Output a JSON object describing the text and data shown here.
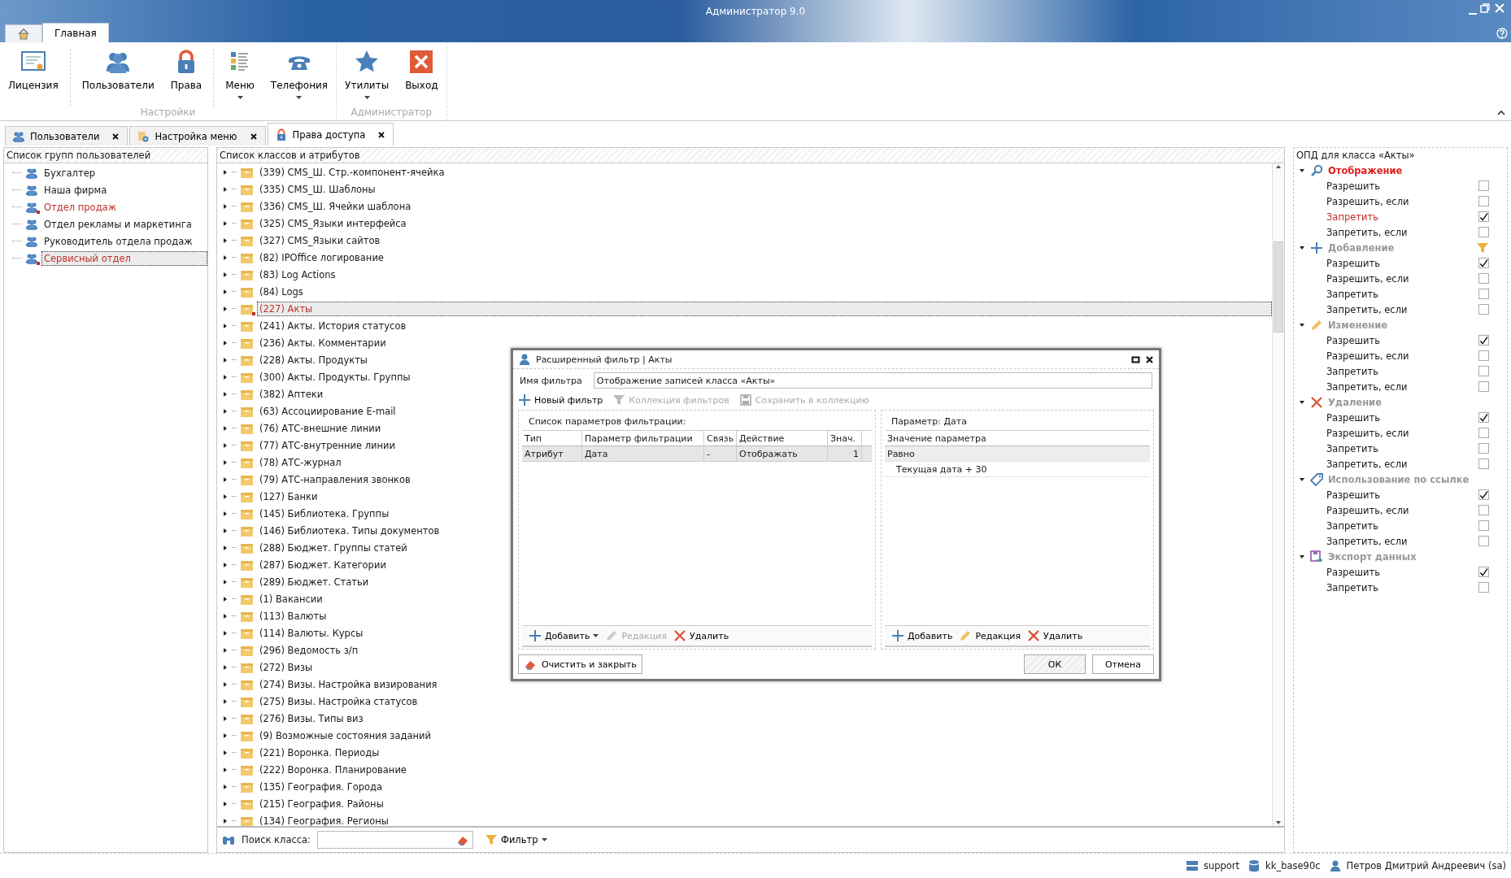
{
  "window": {
    "title": "Администратор 9.0"
  },
  "ribbon_tabs": [
    {
      "kind": "home",
      "selected": false
    },
    {
      "kind": "text",
      "label": "Главная",
      "selected": true
    }
  ],
  "ribbon_groups": [
    {
      "label": "Настройки",
      "buttons": [
        {
          "label": "Лицензия",
          "dropdown": false,
          "separated": false
        },
        {
          "label": "Пользователи",
          "dropdown": false,
          "separated": true
        },
        {
          "label": "Права",
          "dropdown": false,
          "separated": false
        },
        {
          "label": "Меню",
          "dropdown": true,
          "separated": true
        },
        {
          "label": "Телефония",
          "dropdown": true,
          "separated": false
        }
      ]
    },
    {
      "label": "Администратор",
      "buttons": [
        {
          "label": "Утилиты",
          "dropdown": true,
          "separated": false
        },
        {
          "label": "Выход",
          "dropdown": false,
          "separated": false
        }
      ]
    }
  ],
  "doc_tabs": [
    {
      "label": "Пользователи",
      "selected": false
    },
    {
      "label": "Настройка меню",
      "selected": false
    },
    {
      "label": "Права доступа",
      "selected": true
    }
  ],
  "groups_panel": {
    "title": "Список групп пользователей",
    "items": [
      {
        "label": "Бухгалтер",
        "restricted": false,
        "selected": false
      },
      {
        "label": "Наша фирма",
        "restricted": false,
        "selected": false
      },
      {
        "label": "Отдел продаж",
        "restricted": true,
        "selected": false
      },
      {
        "label": "Отдел рекламы и маркетинга",
        "restricted": false,
        "selected": false
      },
      {
        "label": "Руководитель отдела продаж",
        "restricted": false,
        "selected": false
      },
      {
        "label": "Сервисный отдел",
        "restricted": true,
        "selected": true
      }
    ]
  },
  "classes_panel": {
    "title": "Список классов и атрибутов",
    "items": [
      {
        "label": "(339) CMS_Ш. Стр.-компонент-ячейка",
        "restricted": false,
        "selected": false
      },
      {
        "label": "(335) CMS_Ш. Шаблоны",
        "restricted": false,
        "selected": false
      },
      {
        "label": "(336) CMS_Ш. Ячейки шаблона",
        "restricted": false,
        "selected": false
      },
      {
        "label": "(325) CMS_Языки интерфейса",
        "restricted": false,
        "selected": false
      },
      {
        "label": "(327) CMS_Языки сайтов",
        "restricted": false,
        "selected": false
      },
      {
        "label": "(82) IPOffice логирование",
        "restricted": false,
        "selected": false
      },
      {
        "label": "(83) Log Actions",
        "restricted": false,
        "selected": false
      },
      {
        "label": "(84) Logs",
        "restricted": false,
        "selected": false
      },
      {
        "label": "(227) Акты",
        "restricted": true,
        "selected": true
      },
      {
        "label": "(241) Акты. История статусов",
        "restricted": false,
        "selected": false
      },
      {
        "label": "(236) Акты. Комментарии",
        "restricted": false,
        "selected": false
      },
      {
        "label": "(228) Акты. Продукты",
        "restricted": false,
        "selected": false
      },
      {
        "label": "(300) Акты. Продукты. Группы",
        "restricted": false,
        "selected": false
      },
      {
        "label": "(382) Аптеки",
        "restricted": false,
        "selected": false
      },
      {
        "label": "(63) Ассоциирование E-mail",
        "restricted": false,
        "selected": false
      },
      {
        "label": "(76) АТС-внешние линии",
        "restricted": false,
        "selected": false
      },
      {
        "label": "(77) АТС-внутренние линии",
        "restricted": false,
        "selected": false
      },
      {
        "label": "(78) АТС-журнал",
        "restricted": false,
        "selected": false
      },
      {
        "label": "(79) АТС-направления звонков",
        "restricted": false,
        "selected": false
      },
      {
        "label": "(127) Банки",
        "restricted": false,
        "selected": false
      },
      {
        "label": "(145) Библиотека. Группы",
        "restricted": false,
        "selected": false
      },
      {
        "label": "(146) Библиотека. Типы документов",
        "restricted": false,
        "selected": false
      },
      {
        "label": "(288) Бюджет. Группы статей",
        "restricted": false,
        "selected": false
      },
      {
        "label": "(287) Бюджет. Категории",
        "restricted": false,
        "selected": false
      },
      {
        "label": "(289) Бюджет. Статьи",
        "restricted": false,
        "selected": false
      },
      {
        "label": "(1) Вакансии",
        "restricted": false,
        "selected": false
      },
      {
        "label": "(113) Валюты",
        "restricted": false,
        "selected": false
      },
      {
        "label": "(114) Валюты. Курсы",
        "restricted": false,
        "selected": false
      },
      {
        "label": "(296) Ведомость з/п",
        "restricted": false,
        "selected": false
      },
      {
        "label": "(272) Визы",
        "restricted": false,
        "selected": false
      },
      {
        "label": "(274) Визы. Настройка визирования",
        "restricted": false,
        "selected": false
      },
      {
        "label": "(275) Визы. Настройка статусов",
        "restricted": false,
        "selected": false
      },
      {
        "label": "(276) Визы. Типы виз",
        "restricted": false,
        "selected": false
      },
      {
        "label": "(9) Возможные состояния заданий",
        "restricted": false,
        "selected": false
      },
      {
        "label": "(221) Воронка. Периоды",
        "restricted": false,
        "selected": false
      },
      {
        "label": "(222) Воронка. Планирование",
        "restricted": false,
        "selected": false
      },
      {
        "label": "(135) География. Города",
        "restricted": false,
        "selected": false
      },
      {
        "label": "(215) География. Районы",
        "restricted": false,
        "selected": false
      },
      {
        "label": "(134) География. Регионы",
        "restricted": false,
        "selected": false
      }
    ],
    "search": {
      "label": "Поиск класса:",
      "filter_button": "Фильтр"
    }
  },
  "permissions_panel": {
    "title": "ОПД для класса «Акты»",
    "groups": [
      {
        "kind": "view",
        "title": "Отображение",
        "highlighted": true,
        "filtered": false,
        "options": [
          {
            "label": "Разрешить",
            "checked": false,
            "denied": false
          },
          {
            "label": "Разрешить, если",
            "checked": false,
            "denied": false
          },
          {
            "label": "Запретить",
            "checked": true,
            "denied": true
          },
          {
            "label": "Запретить, если",
            "checked": false,
            "denied": false
          }
        ]
      },
      {
        "kind": "add",
        "title": "Добавление",
        "highlighted": false,
        "filtered": true,
        "options": [
          {
            "label": "Разрешить",
            "checked": true,
            "denied": false
          },
          {
            "label": "Разрешить, если",
            "checked": false,
            "denied": false
          },
          {
            "label": "Запретить",
            "checked": false,
            "denied": false
          },
          {
            "label": "Запретить, если",
            "checked": false,
            "denied": false
          }
        ]
      },
      {
        "kind": "edit",
        "title": "Изменение",
        "highlighted": false,
        "filtered": false,
        "options": [
          {
            "label": "Разрешить",
            "checked": true,
            "denied": false
          },
          {
            "label": "Разрешить, если",
            "checked": false,
            "denied": false
          },
          {
            "label": "Запретить",
            "checked": false,
            "denied": false
          },
          {
            "label": "Запретить, если",
            "checked": false,
            "denied": false
          }
        ]
      },
      {
        "kind": "delete",
        "title": "Удаление",
        "highlighted": false,
        "filtered": false,
        "options": [
          {
            "label": "Разрешить",
            "checked": true,
            "denied": false
          },
          {
            "label": "Разрешить, если",
            "checked": false,
            "denied": false
          },
          {
            "label": "Запретить",
            "checked": false,
            "denied": false
          },
          {
            "label": "Запретить, если",
            "checked": false,
            "denied": false
          }
        ]
      },
      {
        "kind": "link",
        "title": "Использование по ссылке",
        "highlighted": false,
        "filtered": false,
        "options": [
          {
            "label": "Разрешить",
            "checked": true,
            "denied": false
          },
          {
            "label": "Разрешить, если",
            "checked": false,
            "denied": false
          },
          {
            "label": "Запретить",
            "checked": false,
            "denied": false
          },
          {
            "label": "Запретить, если",
            "checked": false,
            "denied": false
          }
        ]
      },
      {
        "kind": "export",
        "title": "Экспорт данных",
        "highlighted": false,
        "filtered": false,
        "options": [
          {
            "label": "Разрешить",
            "checked": true,
            "denied": false
          },
          {
            "label": "Запретить",
            "checked": false,
            "denied": false
          }
        ]
      }
    ]
  },
  "dialog": {
    "title": "Расширенный фильтр | Акты",
    "name_label": "Имя фильтра",
    "name_value": "Отображение записей класса «Акты»",
    "toolbar": [
      {
        "kind": "add",
        "label": "Новый фильтр",
        "disabled": false
      },
      {
        "kind": "filter",
        "label": "Коллекция фильтров",
        "disabled": true
      },
      {
        "kind": "save",
        "label": "Сохранить в коллекцию",
        "disabled": true
      }
    ],
    "params": {
      "title": "Список параметров фильтрации:",
      "columns": [
        "Тип",
        "Параметр фильтрации",
        "Связь",
        "Действие",
        "Знач."
      ],
      "rows": [
        {
          "cells": [
            "Атрибут",
            "Дата",
            "-",
            "Отображать",
            "1"
          ],
          "selected": true
        }
      ],
      "actions": [
        {
          "kind": "add",
          "label": "Добавить",
          "disabled": false,
          "dropdown": true
        },
        {
          "kind": "edit",
          "label": "Редакция",
          "disabled": true,
          "dropdown": false
        },
        {
          "kind": "delete",
          "label": "Удалить",
          "disabled": false,
          "dropdown": false
        }
      ]
    },
    "values": {
      "title": "Параметр: Дата",
      "column": "Значение параметра",
      "rows": [
        {
          "label": "Равно",
          "selected": true,
          "children": [
            {
              "label": "Текущая дата + 30",
              "selected": false
            }
          ]
        }
      ],
      "actions": [
        {
          "kind": "add",
          "label": "Добавить",
          "disabled": false,
          "dropdown": false
        },
        {
          "kind": "edit",
          "label": "Редакция",
          "disabled": false,
          "dropdown": false
        },
        {
          "kind": "delete",
          "label": "Удалить",
          "disabled": false,
          "dropdown": false
        }
      ]
    },
    "buttons": [
      {
        "kind": "clear",
        "label": "Очистить и закрыть"
      },
      {
        "kind": "ok",
        "label": "ОК"
      },
      {
        "kind": "cancel",
        "label": "Отмена"
      }
    ]
  },
  "status_bar": {
    "server": "support",
    "database": "kk_base90c",
    "user": "Петров Дмитрий Андреевич (sa)"
  }
}
